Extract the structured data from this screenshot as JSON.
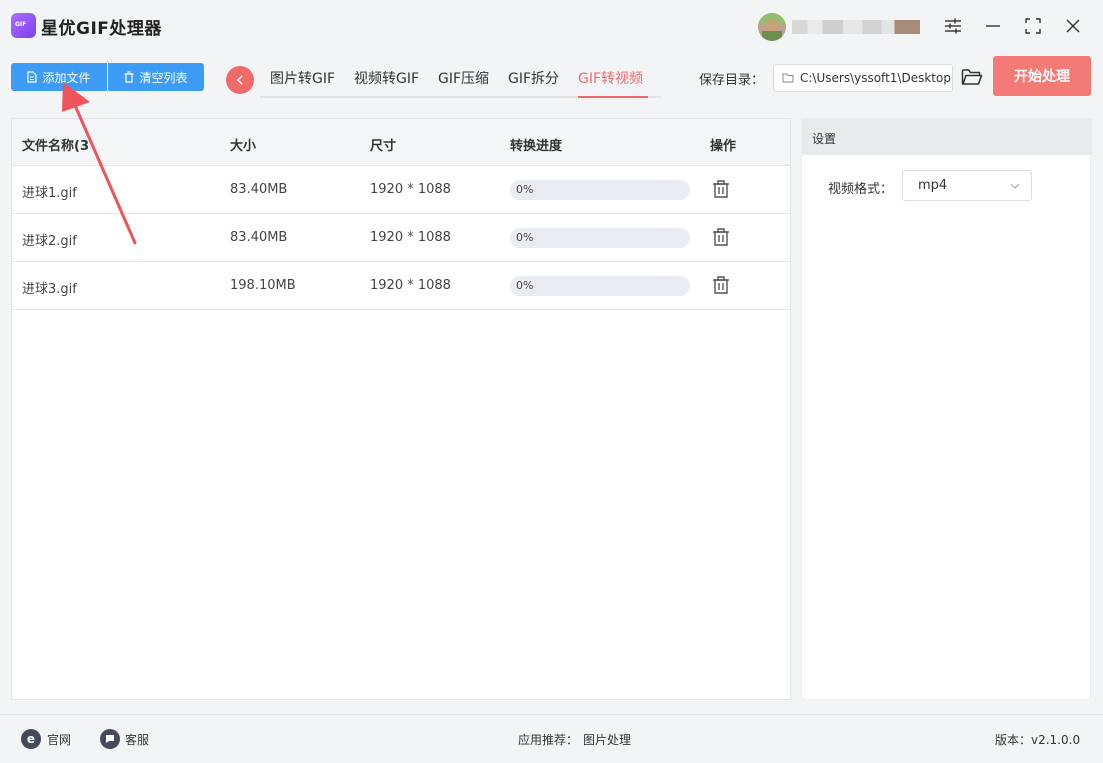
{
  "app": {
    "title": "星优GIF处理器"
  },
  "toolbar": {
    "add_file": "添加文件",
    "clear_list": "清空列表",
    "tabs": [
      "图片转GIF",
      "视频转GIF",
      "GIF压缩",
      "GIF拆分",
      "GIF转视频"
    ],
    "active_tab_index": 4,
    "save_dir_label": "保存目录：",
    "save_dir_value": "C:\\Users\\yssoft1\\Desktop",
    "start_button": "开始处理"
  },
  "table": {
    "headers": {
      "name": "文件名称(3",
      "size": "大小",
      "dimensions": "尺寸",
      "progress": "转换进度",
      "actions": "操作"
    },
    "rows": [
      {
        "name": "进球1.gif",
        "size": "83.40MB",
        "dimensions": "1920 * 1088",
        "progress": "0%",
        "progress_value": 0
      },
      {
        "name": "进球2.gif",
        "size": "83.40MB",
        "dimensions": "1920 * 1088",
        "progress": "0%",
        "progress_value": 0
      },
      {
        "name": "进球3.gif",
        "size": "198.10MB",
        "dimensions": "1920 * 1088",
        "progress": "0%",
        "progress_value": 0
      }
    ]
  },
  "settings": {
    "title": "设置",
    "format_label": "视频格式：",
    "format_value": "mp4"
  },
  "footer": {
    "website": "官网",
    "support": "客服",
    "recommend_label": "应用推荐：",
    "recommend_app": "图片处理",
    "version": "版本：v2.1.0.0"
  },
  "colors": {
    "accent_red": "#f06a6a",
    "primary_blue": "#3d9cf5",
    "start_button": "#f47a76",
    "annotation_arrow": "#f0545a"
  },
  "icons": {
    "add_file": "document-icon",
    "clear_list": "trash-icon",
    "back": "chevron-left-icon",
    "folder": "folder-open-icon",
    "row_action": "trash-icon",
    "select": "chevron-down-icon",
    "website": "browser-e-icon",
    "support": "chat-bubble-icon"
  }
}
